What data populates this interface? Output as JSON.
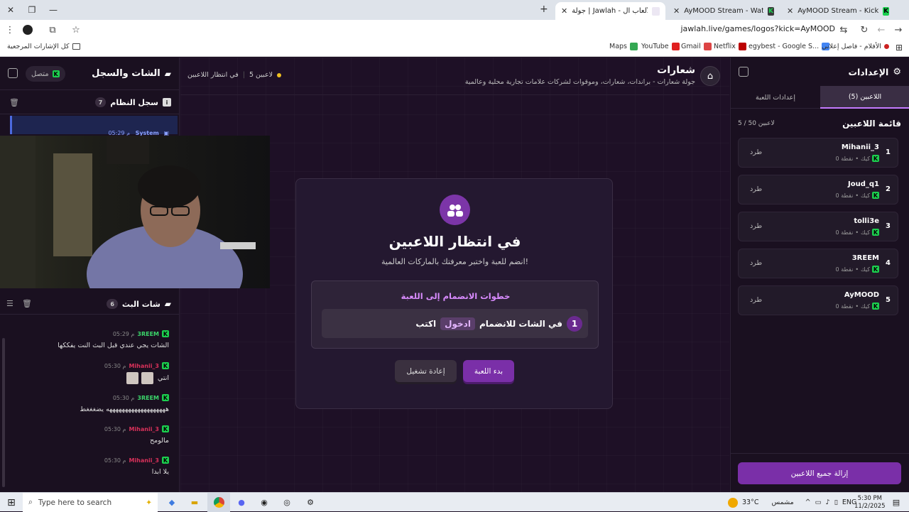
{
  "browser": {
    "tabs": [
      {
        "title": "AyMOOD Stream - Kick Dashbo",
        "favicon": "kick-icon"
      },
      {
        "title": "AyMOOD Stream - Watch Live",
        "favicon": "wave-icon"
      },
      {
        "title": "جولة | Jawlah - منصة الألعاب ال",
        "favicon": "jawlah-icon",
        "active": true
      }
    ],
    "url": "jawlah.live/games/logos?kick=AyMOOD",
    "bookmarks": [
      "Maps",
      "YouTube",
      "Gmail",
      "Netflix",
      "egybest - Google S...",
      "الأفلام - فاصل إعلاني"
    ],
    "all_bookmarks": "كل الإشارات المرجعية"
  },
  "left": {
    "title": "الشات والسجل",
    "status": "متصل",
    "system_log": {
      "title": "سجل النظام",
      "count": "7",
      "sender": "System",
      "time": "05:29 م"
    },
    "stream_chat": {
      "title": "شات البث",
      "count": "6",
      "messages": [
        {
          "user": "3REEM",
          "time": "05:29 م",
          "text": "الشات يجي عندي قبل البث النت يفككها",
          "color": "#3bd56a"
        },
        {
          "user": "Mihanii_3",
          "time": "05:30 م",
          "text": "انتي",
          "color": "#d9315a",
          "emotes": true
        },
        {
          "user": "3REEM",
          "time": "05:30 م",
          "text": "هههههههههههههههههههه يضغغغط",
          "color": "#3bd56a"
        },
        {
          "user": "Mihanii_3",
          "time": "05:30 م",
          "text": "مالومح",
          "color": "#d9315a"
        },
        {
          "user": "Mihanii_3",
          "time": "05:30 م",
          "text": "يلا ابدا",
          "color": "#d9315a"
        }
      ]
    }
  },
  "center": {
    "game_title": "شعارات",
    "game_subtitle": "جولة شعارات - براندات، شعارات، وموقوات لشركات علامات تجارية محلية وعالمية",
    "status": "في انتظار اللاعبين",
    "player_count": "5 لاعبين",
    "card": {
      "title": "في انتظار اللاعبين",
      "subtitle": "انضم للعبة واختبر معرفتك بالماركات العالمية!",
      "steps_title": "خطوات الانضمام إلى اللعبة",
      "step_number": "1",
      "step_prefix": "اكتب",
      "step_keyword": "ادخول",
      "step_suffix": "في الشات للانضمام",
      "start_button": "بدء اللعبة",
      "restart_button": "إعادة تشغيل"
    }
  },
  "right": {
    "title": "الإعدادات",
    "tabs": [
      "اللاعبين (5)",
      "إعدادات اللعبة"
    ],
    "players_title": "قائمة اللاعبين",
    "players_count": "5 / 50 لاعبين",
    "kick_label": "طرد",
    "platform_label": "كيك",
    "players": [
      {
        "index": "1",
        "name": "Mihanii_3",
        "points": "0 نقطة"
      },
      {
        "index": "2",
        "name": "Joud_q1",
        "points": "0 نقطة"
      },
      {
        "index": "3",
        "name": "tolli3e",
        "points": "0 نقطة"
      },
      {
        "index": "4",
        "name": "3REEM",
        "points": "0 نقطة"
      },
      {
        "index": "5",
        "name": "AyMOOD",
        "points": "0 نقطة"
      }
    ],
    "clear_button": "إزالة جميع اللاعبين"
  },
  "taskbar": {
    "search_placeholder": "Type here to search",
    "weather": "33°C",
    "weather_desc": "مشمس",
    "lang": "ENG",
    "time": "5:30 PM",
    "date": "11/2/2025"
  },
  "colors": {
    "accent": "#7a2fa8",
    "kick_green": "#1ccf4f"
  }
}
